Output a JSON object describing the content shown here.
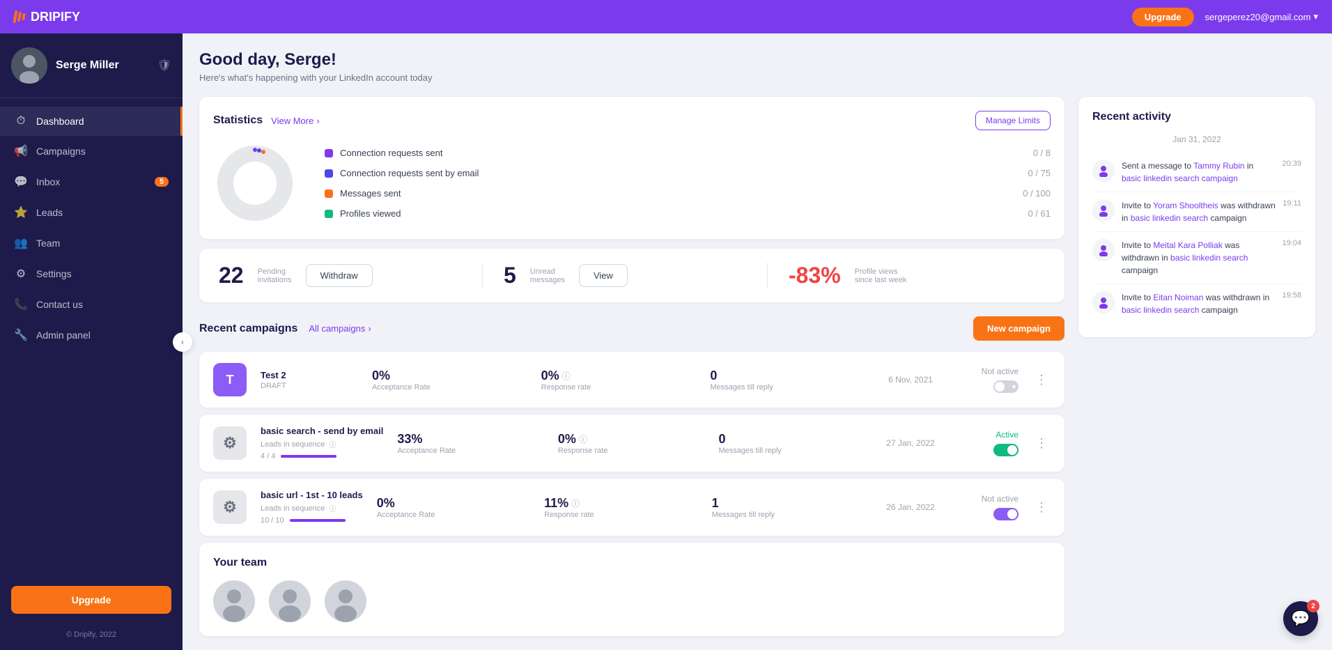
{
  "topnav": {
    "logo_text": "DRIPIFY",
    "upgrade_label": "Upgrade",
    "user_email": "sergeperez20@gmail.com"
  },
  "sidebar": {
    "user_name": "Serge Miller",
    "nav_items": [
      {
        "label": "Dashboard",
        "icon": "⏱",
        "active": true,
        "badge": null
      },
      {
        "label": "Campaigns",
        "icon": "📢",
        "active": false,
        "badge": null
      },
      {
        "label": "Inbox",
        "icon": "💬",
        "active": false,
        "badge": "5"
      },
      {
        "label": "Leads",
        "icon": "⭐",
        "active": false,
        "badge": null
      },
      {
        "label": "Team",
        "icon": "👥",
        "active": false,
        "badge": null
      },
      {
        "label": "Settings",
        "icon": "⚙",
        "active": false,
        "badge": null
      },
      {
        "label": "Contact us",
        "icon": "📞",
        "active": false,
        "badge": null
      },
      {
        "label": "Admin panel",
        "icon": "🔧",
        "active": false,
        "badge": null
      }
    ],
    "upgrade_label": "Upgrade",
    "footer": "© Dripify, 2022"
  },
  "page_header": {
    "title": "Good day, Serge!",
    "subtitle": "Here's what's happening with your LinkedIn account today"
  },
  "statistics": {
    "title": "Statistics",
    "view_more": "View More",
    "manage_limits": "Manage Limits",
    "legend": [
      {
        "label": "Connection requests sent",
        "value": "0 / 8",
        "color": "#7c3aed"
      },
      {
        "label": "Connection requests sent by email",
        "value": "0 / 75",
        "color": "#4f46e5"
      },
      {
        "label": "Messages sent",
        "value": "0 / 100",
        "color": "#f97316"
      },
      {
        "label": "Profiles viewed",
        "value": "0 / 61",
        "color": "#10b981"
      }
    ]
  },
  "stats_row": {
    "pending": {
      "number": "22",
      "label": "Pending\ninvitations",
      "btn": "Withdraw"
    },
    "unread": {
      "number": "5",
      "label": "Unread\nmessages",
      "btn": "View"
    },
    "profile_views": {
      "number": "-83%",
      "label": "Profile views\nsince last week"
    }
  },
  "campaigns": {
    "title": "Recent campaigns",
    "all_link": "All campaigns",
    "new_btn": "New campaign",
    "items": [
      {
        "icon_type": "letter",
        "icon_text": "T",
        "name": "Test 2",
        "status": "DRAFT",
        "leads_label": null,
        "leads_progress": 0,
        "acceptance_rate": "0%",
        "acceptance_label": "Acceptance Rate",
        "response_rate": "0%",
        "response_label": "Response rate",
        "messages": "0",
        "messages_label": "Messages till reply",
        "date": "6 Nov, 2021",
        "status_text": "Not active",
        "is_active": false
      },
      {
        "icon_type": "gear",
        "icon_text": "⚙",
        "name": "basic search - send by email",
        "status": "Leads in sequence",
        "leads_label": "4 / 4",
        "leads_progress": 100,
        "acceptance_rate": "33%",
        "acceptance_label": "Acceptance Rate",
        "response_rate": "0%",
        "response_label": "Response rate",
        "messages": "0",
        "messages_label": "Messages till reply",
        "date": "27 Jan, 2022",
        "status_text": "Active",
        "is_active": true
      },
      {
        "icon_type": "gear",
        "icon_text": "⚙",
        "name": "basic url - 1st - 10 leads",
        "status": "Leads in sequence",
        "leads_label": "10 / 10",
        "leads_progress": 100,
        "acceptance_rate": "0%",
        "acceptance_label": "Acceptance Rate",
        "response_rate": "11%",
        "response_label": "Response rate",
        "messages": "1",
        "messages_label": "Messages till reply",
        "date": "26 Jan, 2022",
        "status_text": "Not active",
        "is_active": false
      }
    ]
  },
  "team": {
    "title": "Your team"
  },
  "recent_activity": {
    "title": "Recent activity",
    "date_label": "Jan 31, 2022",
    "items": [
      {
        "text_before": "Sent a message to",
        "name": "Tammy Rubin",
        "text_mid": "in",
        "link": "basic linkedin search campaign",
        "time": "20:39"
      },
      {
        "text_before": "Invite to",
        "name": "Yoram Shooltheis",
        "text_mid": "was withdrawn in",
        "link": "basic linkedin search",
        "text_after": "campaign",
        "time": "19:11"
      },
      {
        "text_before": "Invite to",
        "name": "Meital Kara Polliak",
        "text_mid": "was withdrawn in",
        "link": "basic linkedin search",
        "text_after": "campaign",
        "time": "19:04"
      },
      {
        "text_before": "Invite to",
        "name": "Eitan Noiman",
        "text_mid": "was withdrawn in",
        "link": "basic linkedin search",
        "text_after": "campaign",
        "time": "19:58"
      }
    ]
  },
  "chat": {
    "badge": "2"
  }
}
